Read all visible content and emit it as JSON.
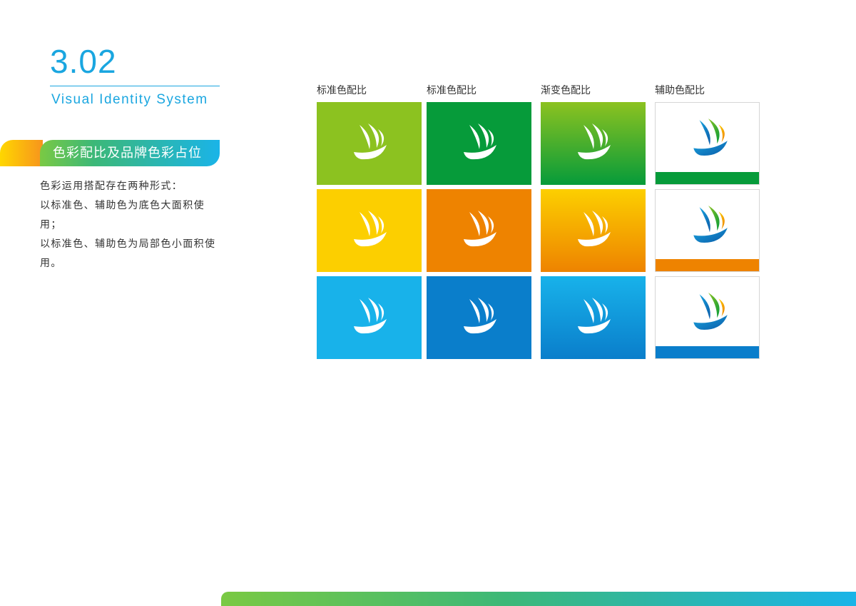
{
  "header": {
    "section_number": "3.02",
    "subtitle": "Visual Identity System"
  },
  "tag": {
    "title": "色彩配比及品牌色彩占位"
  },
  "body": {
    "lines": [
      "色彩运用搭配存在两种形式：",
      "以标准色、辅助色为底色大面积使用；",
      "以标准色、辅助色为局部色小面积使用。"
    ]
  },
  "columns": [
    {
      "label": "标准色配比"
    },
    {
      "label": "标准色配比"
    },
    {
      "label": "渐变色配比"
    },
    {
      "label": "辅助色配比"
    }
  ],
  "colors": {
    "accent_blue": "#1aa6e0",
    "green_light": "#8cc220",
    "green_dark": "#069b3a",
    "yellow": "#fccf00",
    "orange": "#ee8300",
    "blue_light": "#18b2ea",
    "blue_dark": "#0a7ecb",
    "gradient_green": [
      "#8cc220",
      "#069b3a"
    ],
    "gradient_orange": [
      "#fccf00",
      "#ee8300"
    ],
    "gradient_blue": [
      "#18b2ea",
      "#0a7ecb"
    ],
    "stripe_green": "#069b3a",
    "stripe_orange": "#ee8300",
    "stripe_blue": "#0a7ecb"
  },
  "icons": {
    "logo": "sailboat-logo-icon"
  }
}
